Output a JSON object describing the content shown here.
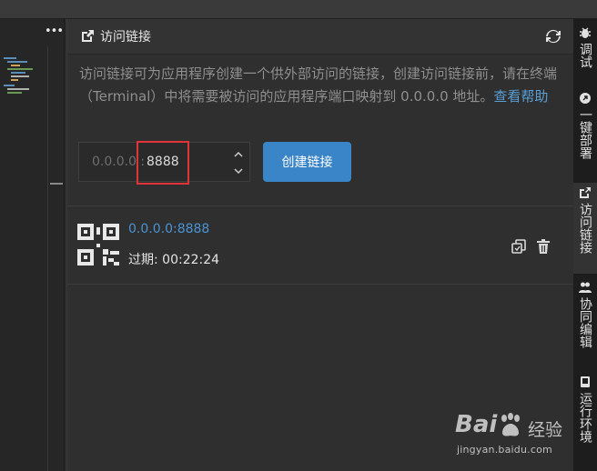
{
  "panel": {
    "title": "访问链接",
    "description": "访问链接可为应用程序创建一个供外部访问的链接，创建访问链接前，请在终端（Terminal）中将需要被访问的应用程序端口映射到 0.0.0.0 地址。",
    "help_link": "查看帮助",
    "address_prefix": "0.0.0.0 :",
    "port_value": "8888",
    "create_button": "创建链接",
    "links": [
      {
        "url": "0.0.0.0:8888",
        "expire_label": "过期:",
        "expire_time": "00:22:24"
      }
    ]
  },
  "sidebar": {
    "tabs": [
      {
        "label": "调试",
        "icon": "bug-icon"
      },
      {
        "label": "一键部署",
        "icon": "rocket-icon"
      },
      {
        "label": "访问链接",
        "icon": "external-link-icon"
      },
      {
        "label": "协同编辑",
        "icon": "users-icon"
      },
      {
        "label": "运行环境",
        "icon": "server-icon"
      }
    ]
  },
  "watermark": {
    "brand": "Bai",
    "brand2": "经验",
    "url": "jingyan.baidu.com"
  },
  "colors": {
    "accent": "#3a84c8",
    "link": "#4a93d4",
    "highlight_box": "#e0343a"
  }
}
